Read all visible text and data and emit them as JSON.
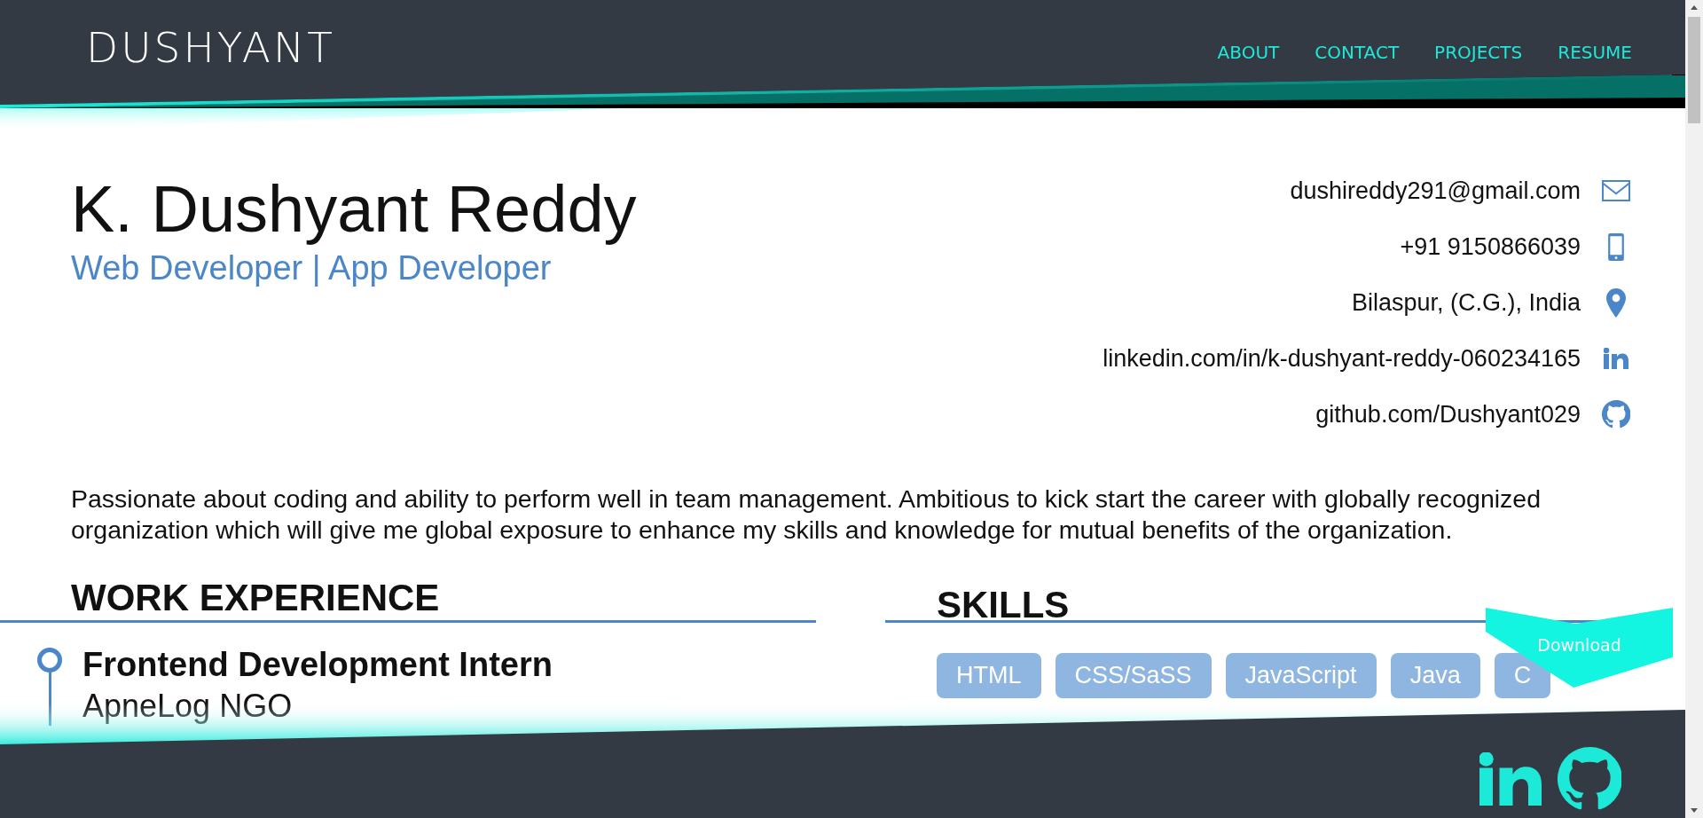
{
  "header": {
    "logo": "DUSHYANT",
    "nav": [
      {
        "label": "ABOUT"
      },
      {
        "label": "CONTACT"
      },
      {
        "label": "PROJECTS"
      },
      {
        "label": "RESUME"
      }
    ]
  },
  "profile": {
    "name": "K. Dushyant Reddy",
    "title": "Web Developer | App Developer"
  },
  "contacts": [
    {
      "kind": "email",
      "text": "dushireddy291@gmail.com"
    },
    {
      "kind": "phone",
      "text": "+91 9150866039"
    },
    {
      "kind": "location",
      "text": "Bilaspur, (C.G.), India"
    },
    {
      "kind": "linkedin",
      "text": "linkedin.com/in/k-dushyant-reddy-060234165"
    },
    {
      "kind": "github",
      "text": "github.com/Dushyant029"
    }
  ],
  "summary": "Passionate about coding and ability to perform well in team management. Ambitious to kick start the career with globally recognized organization which will give me global exposure to enhance my skills and knowledge for mutual benefits of the organization.",
  "work_experience": {
    "heading": "WORK EXPERIENCE",
    "items": [
      {
        "role": "Frontend Development Intern",
        "company": "ApneLog NGO"
      }
    ]
  },
  "skills": {
    "heading": "SKILLS",
    "items": [
      "HTML",
      "CSS/SaSS",
      "JavaScript",
      "Java",
      "C"
    ]
  },
  "download_button": "Download",
  "footer": {
    "social": [
      {
        "kind": "linkedin"
      },
      {
        "kind": "github"
      }
    ]
  }
}
